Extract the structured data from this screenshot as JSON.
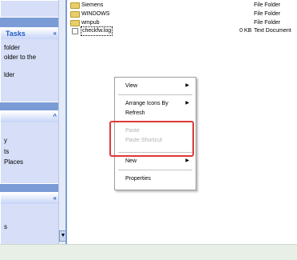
{
  "files": [
    {
      "name": "Siemens",
      "icon": "folder-icon",
      "size": "",
      "type": "File Folder"
    },
    {
      "name": "WINDOWS",
      "icon": "folder-icon",
      "size": "",
      "type": "File Folder"
    },
    {
      "name": "wmpub",
      "icon": "folder-icon",
      "size": "",
      "type": "File Folder"
    },
    {
      "name": "checkfw.log",
      "icon": "text-document-icon",
      "size": "0 KB",
      "type": "Text Document"
    }
  ],
  "task_pane": {
    "tasks_header": "Tasks",
    "tasks_lines": [
      "folder",
      "older to the",
      "lder"
    ],
    "places_lines": [
      "y",
      "ts",
      "Places"
    ],
    "details_lines": [
      "s"
    ],
    "collapse_glyph": "«",
    "expand_glyph": "^"
  },
  "scrollbar": {
    "down_glyph": "▼"
  },
  "context_menu": {
    "items": [
      {
        "label": "View",
        "submenu": true,
        "enabled": true
      },
      {
        "label": "Arrange Icons By",
        "submenu": true,
        "enabled": true
      },
      {
        "label": "Refresh",
        "submenu": false,
        "enabled": true
      },
      {
        "label": "Paste",
        "submenu": false,
        "enabled": false
      },
      {
        "label": "Paste Shortcut",
        "submenu": false,
        "enabled": false
      },
      {
        "label": "New",
        "submenu": true,
        "enabled": true
      },
      {
        "label": "Properties",
        "submenu": false,
        "enabled": true
      }
    ],
    "submenu_glyph": "▶"
  },
  "colors": {
    "highlight_border": "#e03838",
    "taskpane_bg": "#7a9bd6",
    "status_bg": "#e8efe7"
  }
}
